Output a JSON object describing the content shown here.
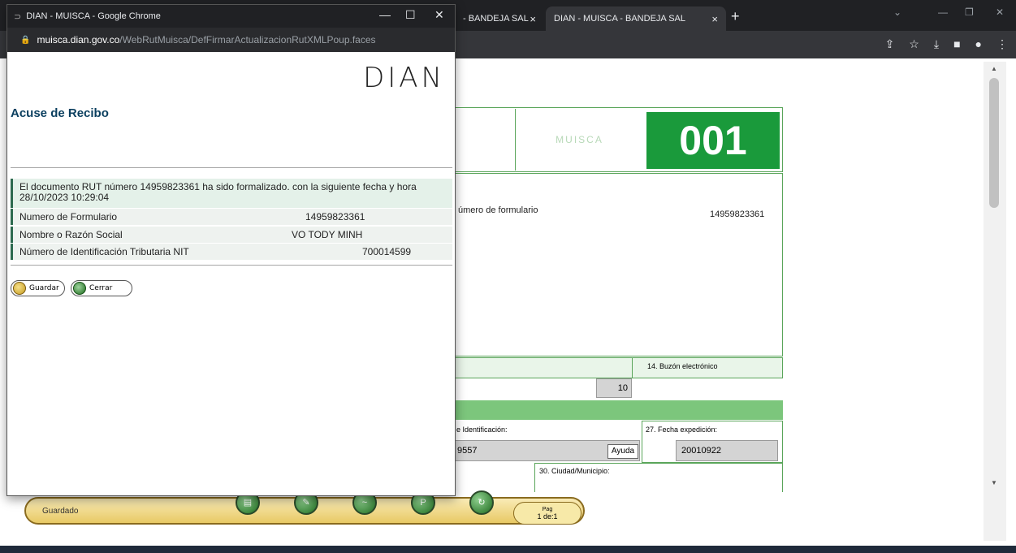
{
  "background_browser": {
    "tab1_title": "- BANDEJA SAL",
    "tab2_title": "DIAN - MUISCA - BANDEJA SAL",
    "tab_close": "×",
    "new_tab": "+"
  },
  "popup": {
    "window_title": "DIAN - MUISCA - Google Chrome",
    "url_host": "muisca.dian.gov.co",
    "url_path": "/WebRutMuisca/DefFirmarActualizacionRutXMLPoup.faces",
    "logo_text": "DIAN",
    "heading": "Acuse de Recibo",
    "message_line1": "El documento RUT número 14959823361 ha sido formalizado. con la siguiente fecha y hora",
    "message_line2": "28/10/2023 10:29:04",
    "rows": [
      {
        "label": "Numero de Formulario",
        "value": "14959823361"
      },
      {
        "label": "Nombre o Razón Social",
        "value": "VO TODY MINH"
      },
      {
        "label": "Número de Identificación Tributaria NIT",
        "value": "700014599"
      }
    ],
    "save_button": "Guardar",
    "close_button": "Cerrar"
  },
  "form": {
    "badge": "001",
    "form_number_label": "úmero de formulario",
    "form_number_value": "14959823361",
    "buzon_label": "14. Buzón electrónico",
    "ten_value": "10",
    "ident_label": "e Identificación:",
    "ident_value": "9557",
    "ayuda": "Ayuda",
    "fecha_label": "27. Fecha expedición:",
    "fecha_value": "20010922",
    "ciudad_label": "30. Ciudad/Municipio:",
    "status_text": "Guardado",
    "pag_label": "Pag",
    "pag_value": "1 de:1"
  }
}
